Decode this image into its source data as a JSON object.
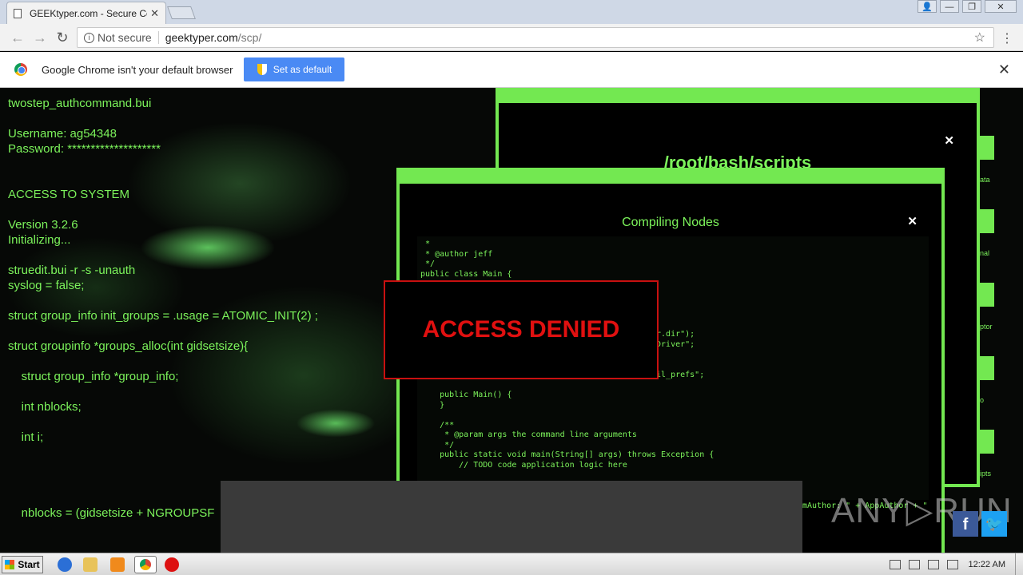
{
  "browser": {
    "tab_title": "GEEKtyper.com - Secure Co",
    "tab_close": "✕",
    "not_secure": "Not secure",
    "url_host": "geektyper.com",
    "url_path": "/scp/"
  },
  "infobar": {
    "message": "Google Chrome isn't your default browser",
    "button": "Set as default",
    "close": "✕"
  },
  "terminal": {
    "lines": [
      "twostep_authcommand.bui",
      "",
      "Username: ag54348",
      "Password: ********************",
      "",
      "",
      "ACCESS TO SYSTEM",
      "",
      "Version 3.2.6",
      "Initializing...",
      "",
      "struedit.bui -r -s -unauth",
      "syslog = false;",
      "",
      "struct group_info init_groups = .usage = ATOMIC_INIT(2) ;",
      "",
      "struct groupinfo *groups_alloc(int gidsetsize){",
      "",
      "    struct group_info *group_info;",
      "",
      "    int nblocks;",
      "",
      "    int i;",
      "",
      "",
      "",
      "",
      "    nblocks = (gidsetsize + NGROUPSF"
    ]
  },
  "window_scripts": {
    "title": "/root/bash/scripts",
    "close": "✕"
  },
  "side_labels": [
    "ata",
    "nal",
    "ptor",
    "o",
    "ipts"
  ],
  "window_compile": {
    "title": "Compiling Nodes",
    "close": "✕",
    "code": " *\n * @author jeff\n */\npublic class Main {\n\n\n\n                                        \";\n                                        007\";\n                                        erty(\"user.dir\");\n                                        tabase.SSDriver\";\n                                        :sql:\";\n                                        sqlmail\";\n                                        + \"/sqlmail_prefs\";\n\n    public Main() {\n    }\n\n    /**\n     * @param args the command line arguments\n     */\n    public static void main(String[] args) throws Exception {\n        // TODO code application logic here\n\n        boolean bDBConnect = false;"
  },
  "alert": {
    "text": "ACCESS DENIED"
  },
  "author_line": "mAuthor: \" + AppAuthor + \"",
  "watermark": "ANY▷RUN",
  "social": {
    "facebook": "f",
    "twitter": "🐦"
  },
  "taskbar": {
    "start": "Start",
    "clock": "12:22 AM"
  }
}
